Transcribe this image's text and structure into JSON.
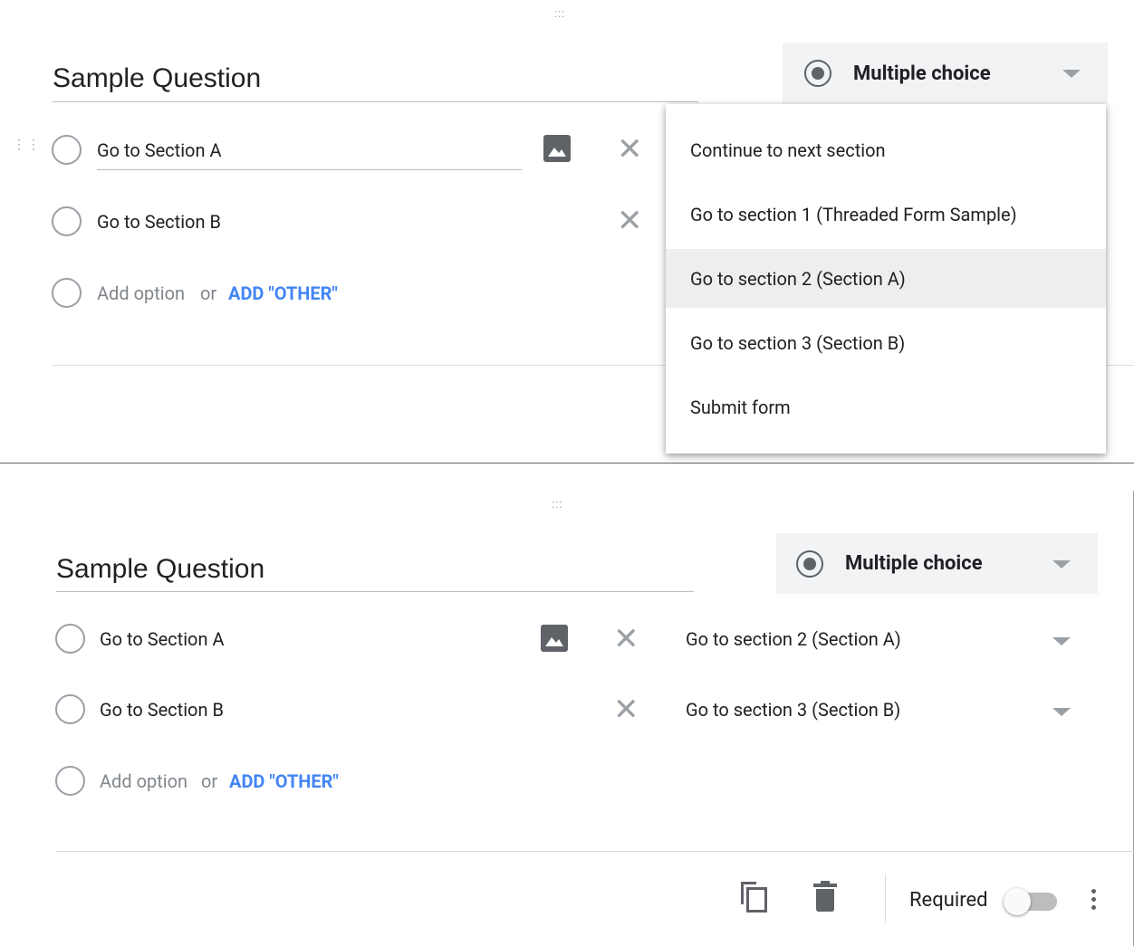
{
  "drag_handle": ":::",
  "side_drag_handle": "⋮⋮",
  "top_card": {
    "title": "Sample Question",
    "type_label": "Multiple choice",
    "options": [
      {
        "label": "Go to Section A"
      },
      {
        "label": "Go to Section B"
      }
    ],
    "add_option": "Add option",
    "or": "or",
    "add_other": "ADD \"OTHER\"",
    "dropdown_menu": {
      "items": [
        {
          "label": "Continue to next section"
        },
        {
          "label": "Go to section 1 (Threaded Form Sample)"
        },
        {
          "label": "Go to section 2 (Section A)",
          "highlighted": true
        },
        {
          "label": "Go to section 3 (Section B)"
        },
        {
          "label": "Submit form"
        }
      ]
    }
  },
  "bottom_card": {
    "title": "Sample Question",
    "type_label": "Multiple choice",
    "options": [
      {
        "label": "Go to Section A",
        "goto": "Go to section 2 (Section A)"
      },
      {
        "label": "Go to Section B",
        "goto": "Go to section 3 (Section B)"
      }
    ],
    "add_option": "Add option",
    "or": "or",
    "add_other": "ADD \"OTHER\"",
    "footer": {
      "required_label": "Required",
      "required_on": false
    }
  },
  "icons": {
    "image": "image-icon",
    "remove": "close-icon",
    "duplicate": "copy-icon",
    "delete": "trash-icon",
    "more": "more-vert-icon",
    "type": "radio-button-icon",
    "dropdown": "caret-down-icon",
    "drag": "drag-handle-icon"
  },
  "colors": {
    "accent": "#4285f4",
    "menu_highlight": "#eeeeee",
    "type_bg": "#f1f3f4",
    "icon_gray": "#5f6368",
    "light_gray": "#9aa0a6"
  }
}
